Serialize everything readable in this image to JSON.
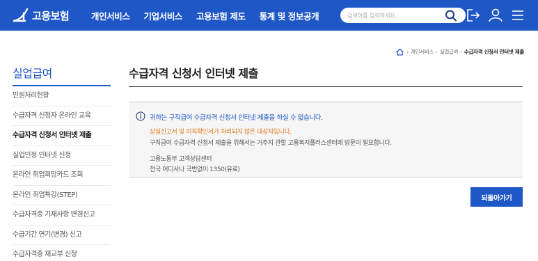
{
  "header": {
    "logo_text": "고용보험",
    "nav": [
      "개인서비스",
      "기업서비스",
      "고용보험 제도",
      "통계 및 정보공개"
    ],
    "search_placeholder": "검색어를 입력하세요.",
    "brand_color": "#1f57c7"
  },
  "breadcrumb": {
    "items": [
      "개인서비스",
      "실업급여",
      "수급자격 신청서 인터넷 제출"
    ]
  },
  "sidebar": {
    "title": "실업급여",
    "items": [
      {
        "label": "민원처리현황"
      },
      {
        "label": "수급자격 신청자 온라인 교육"
      },
      {
        "label": "수급자격 신청서 인터넷 제출",
        "active": true
      },
      {
        "label": "실업인정 인터넷 신청"
      },
      {
        "label": "온라인 취업희망카드 조회"
      },
      {
        "label": "온라인 취업특강(STEP)"
      },
      {
        "label": "수급자격증 기재사항 변경신고"
      },
      {
        "label": "수급기간 연기(변경) 신고"
      },
      {
        "label": "수급자격증 재교부 신청"
      }
    ]
  },
  "main": {
    "title": "수급자격 신청서 인터넷 제출",
    "notice": {
      "heading": "귀하는 구직급여 수급자격 신청서 인터넷 제출을 하실 수 없습니다.",
      "warning": "상실신고서 및 이직확인서가 처리되지 않은 대상자입니다.",
      "body": "구직급여 수급자격 신청서 제출을 위해서는 거주지 관할 고용복지플러스센터에 방문이 필요합니다.",
      "contact_name": "고용노동부 고객상담센터",
      "contact_phone": "전국 어디서나 국번없이 1350(유료)"
    },
    "back_label": "되돌아가기"
  },
  "icons": [
    "home-icon",
    "search-icon",
    "logout-icon",
    "user-icon",
    "menu-icon",
    "info-icon"
  ]
}
